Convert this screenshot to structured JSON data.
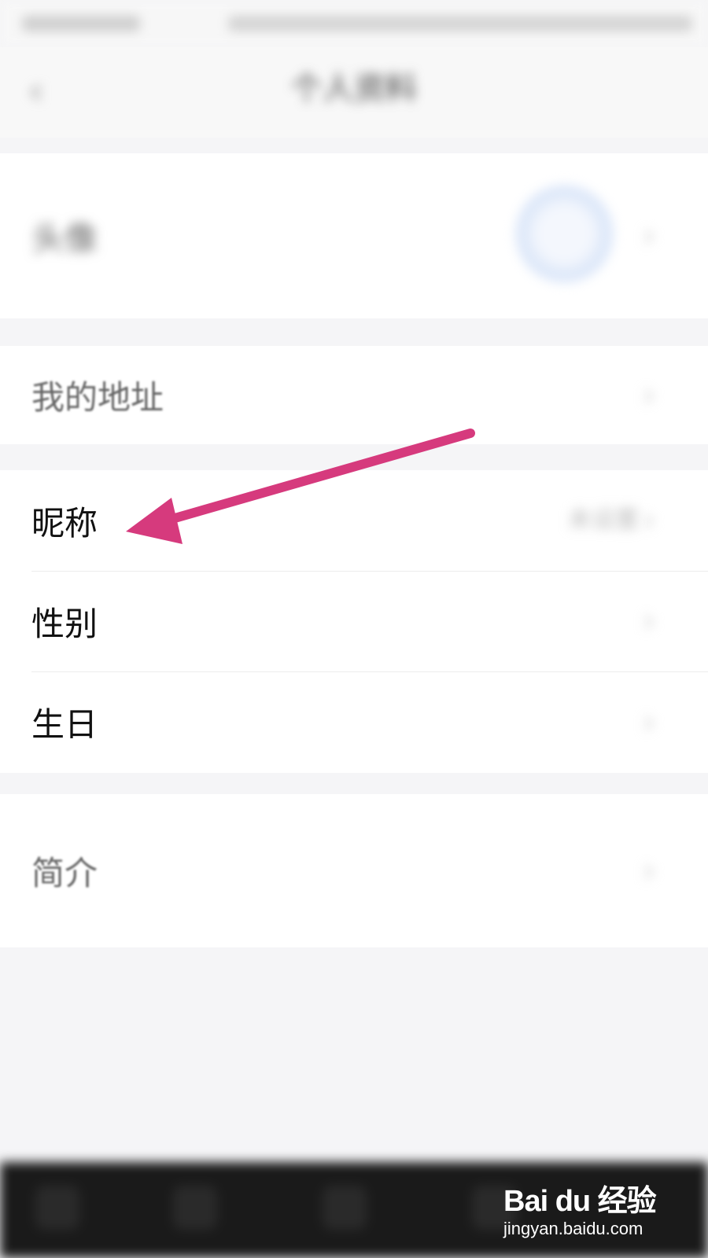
{
  "header": {
    "title": "个人资料",
    "back_icon": "chevron-left-icon"
  },
  "rows": {
    "avatar": {
      "label": "头像"
    },
    "address": {
      "label": "我的地址"
    },
    "nickname": {
      "label": "昵称",
      "value": "未设置"
    },
    "gender": {
      "label": "性别"
    },
    "birthday": {
      "label": "生日"
    },
    "bio": {
      "label": "简介"
    }
  },
  "annotation": {
    "arrow_color": "#d63a7d",
    "target": "昵称"
  },
  "watermark": {
    "brand": "Bai du 经验",
    "url": "jingyan.baidu.com"
  },
  "icons": {
    "chevron": "chevron-right-icon"
  }
}
